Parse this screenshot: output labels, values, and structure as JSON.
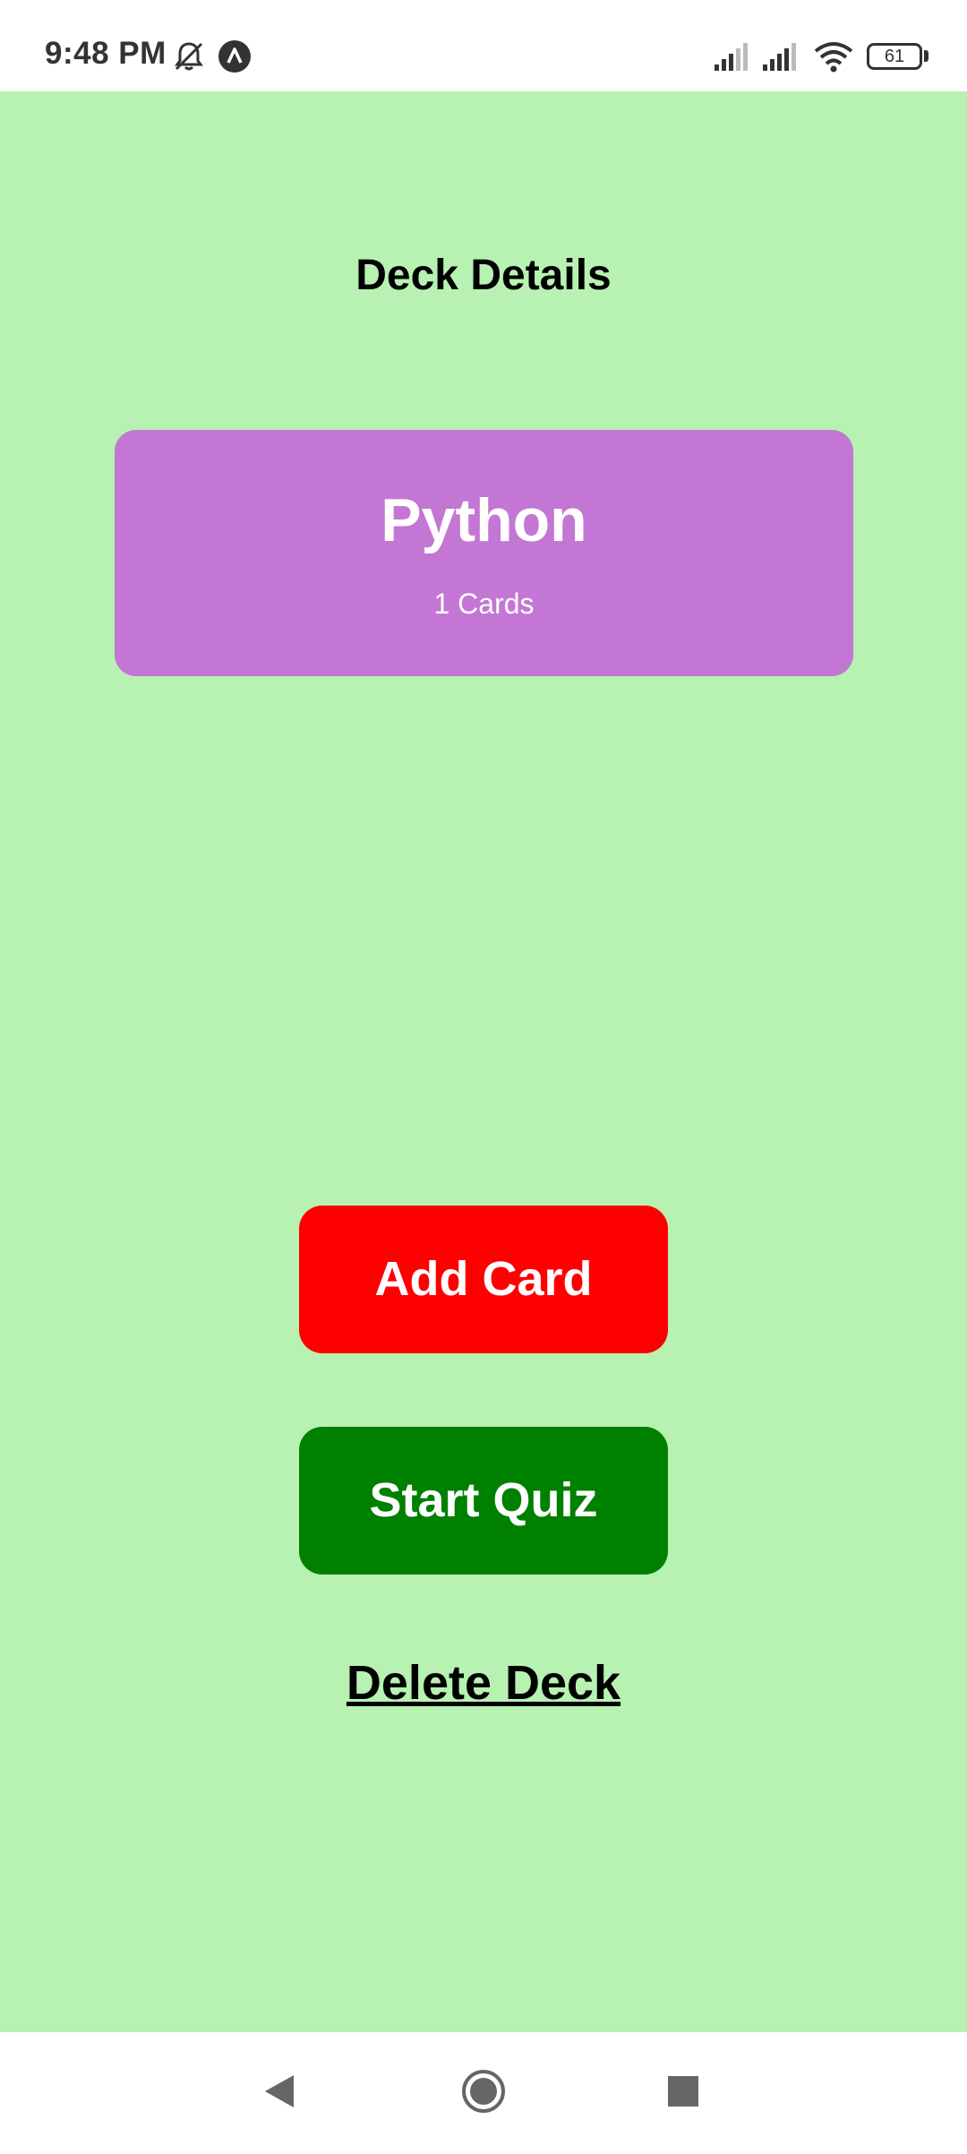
{
  "status_bar": {
    "time": "9:48 PM",
    "icons": [
      "mute-icon",
      "app-notification-icon",
      "signal-icon",
      "signal-icon",
      "wifi-icon",
      "battery-icon"
    ],
    "battery_level": "61"
  },
  "screen": {
    "title": "Deck Details",
    "background_color": "#b7f2b2"
  },
  "deck": {
    "name": "Python",
    "count_label": "1 Cards",
    "color": "#c476d4"
  },
  "actions": {
    "add_card_label": "Add Card",
    "add_card_color": "#ff0000",
    "start_quiz_label": "Start Quiz",
    "start_quiz_color": "#008000",
    "delete_deck_label": "Delete Deck"
  },
  "nav_bar": {
    "icons": [
      "back-icon",
      "home-icon",
      "recents-icon"
    ]
  }
}
